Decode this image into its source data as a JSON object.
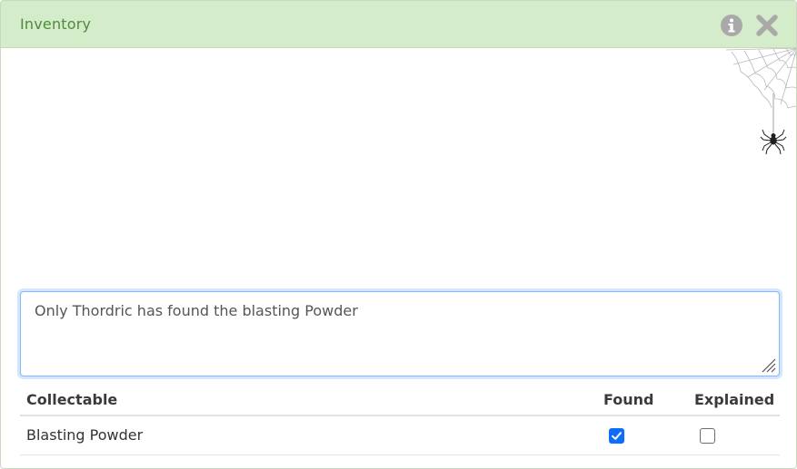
{
  "dialog": {
    "title": "Inventory",
    "info_icon": "info-icon",
    "close_icon": "close-icon",
    "decoration_icon": "spider-web-icon"
  },
  "note": {
    "value": "Only Thordric has found the blasting Powder"
  },
  "table": {
    "headers": [
      "Collectable",
      "Found",
      "Explained"
    ],
    "rows": [
      {
        "name": "Blasting Powder",
        "found": true,
        "explained": false
      }
    ]
  },
  "colors": {
    "titlebar_bg": "#d4ecca",
    "title_text": "#4f8a3e",
    "checkbox_checked": "#0d6efd",
    "focus_border": "#86b7fe"
  }
}
